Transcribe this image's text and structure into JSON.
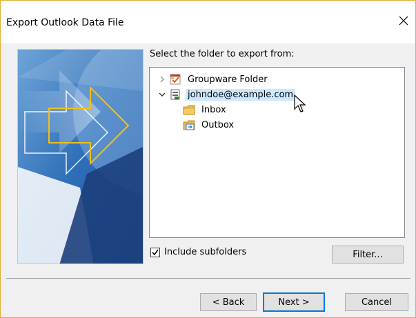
{
  "window": {
    "title": "Export Outlook Data File",
    "close_label": "×"
  },
  "prompt": "Select the folder to export from:",
  "tree": {
    "items": [
      {
        "label": "Groupware Folder",
        "expanded": false,
        "icon": "groupware-folder-icon"
      },
      {
        "label": "johndoe@example.com",
        "expanded": true,
        "selected": true,
        "icon": "mailbox-icon"
      },
      {
        "label": "Inbox",
        "icon": "inbox-folder-icon"
      },
      {
        "label": "Outbox",
        "icon": "outbox-folder-icon"
      }
    ]
  },
  "options": {
    "include_subfolders_label": "Include subfolders",
    "include_subfolders_checked": true
  },
  "buttons": {
    "filter": "Filter...",
    "back": "< Back",
    "next": "Next >",
    "cancel": "Cancel"
  },
  "colors": {
    "selection": "#cce8ff",
    "primary_border": "#0078d7",
    "banner_arrow": "#f0c020"
  }
}
